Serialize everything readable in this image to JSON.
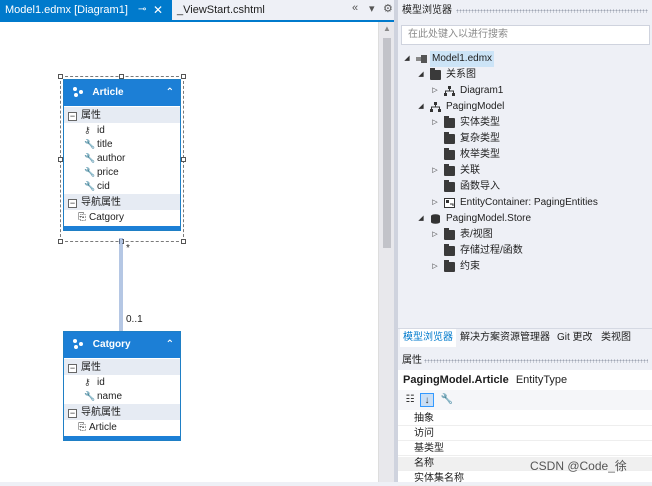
{
  "tabs": {
    "active_label": "Model1.edmx [Diagram1]",
    "second_label": "_ViewStart.cshtml",
    "pin_glyph": "⊸",
    "close_glyph": "✕",
    "tools": [
      "«",
      "▾",
      "⚙"
    ]
  },
  "diagram": {
    "entities": [
      {
        "name": "Article",
        "properties_header": "属性",
        "properties": [
          {
            "name": "id",
            "icon": "key-icon"
          },
          {
            "name": "title",
            "icon": "wrench-icon"
          },
          {
            "name": "author",
            "icon": "wrench-icon"
          },
          {
            "name": "price",
            "icon": "wrench-icon"
          },
          {
            "name": "cid",
            "icon": "wrench-icon"
          }
        ],
        "nav_header": "导航属性",
        "nav_properties": [
          "Catgory"
        ]
      },
      {
        "name": "Catgory",
        "properties_header": "属性",
        "properties": [
          {
            "name": "id",
            "icon": "key-icon"
          },
          {
            "name": "name",
            "icon": "wrench-icon"
          }
        ],
        "nav_header": "导航属性",
        "nav_properties": [
          "Article"
        ]
      }
    ],
    "association": {
      "upper_multiplicity": "*",
      "lower_multiplicity": "0..1"
    }
  },
  "model_browser": {
    "title": "模型浏览器",
    "search_placeholder": "在此处键入以进行搜索",
    "tree": {
      "root": "Model1.edmx",
      "diagrams_folder": "关系图",
      "diagram": "Diagram1",
      "model": "PagingModel",
      "entity_types": "实体类型",
      "complex_types": "复杂类型",
      "enum_types": "枚举类型",
      "associations": "关联",
      "function_imports": "函数导入",
      "entity_container": "EntityContainer: PagingEntities",
      "store": "PagingModel.Store",
      "tables_views": "表/视图",
      "procs_funcs": "存储过程/函数",
      "constraints": "约束"
    }
  },
  "bottom_tabs": [
    "模型浏览器",
    "解决方案资源管理器",
    "Git 更改",
    "类视图"
  ],
  "properties": {
    "title": "属性",
    "object_name": "PagingModel.Article",
    "object_type": "EntityType",
    "rows": [
      "抽象",
      "访问",
      "基类型",
      "名称",
      "实体集名称"
    ]
  },
  "watermark": "CSDN @Code_徐",
  "colors": {
    "accent": "#007acc",
    "entity_header": "#1c7fd6"
  }
}
